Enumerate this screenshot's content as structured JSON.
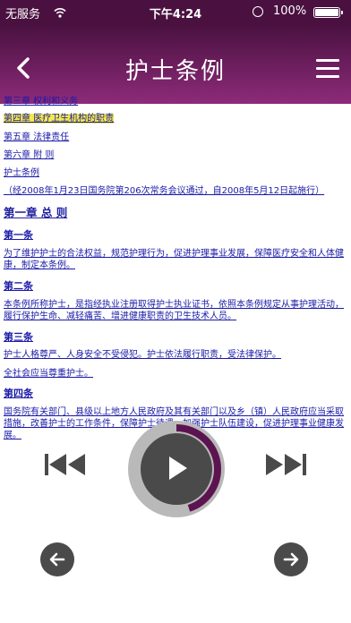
{
  "status_bar": {
    "carrier": "无服务",
    "time": "下午4:24",
    "battery_percent": "100%",
    "icons": [
      "wifi-icon",
      "orientation-lock-icon",
      "battery-icon"
    ]
  },
  "nav": {
    "title": "护士条例",
    "back_icon": "chevron-left-icon",
    "menu_icon": "hamburger-menu-icon"
  },
  "content": {
    "lines": [
      "第三章 权利和义务",
      "第四章 医疗卫生机构的职责",
      "第五章 法律责任",
      "第六章 附 则",
      "护士条例",
      "（经2008年1月23日国务院第206次常务会议通过，自2008年5月12日起施行）",
      "第一章 总 则",
      "第一条",
      "为了维护护士的合法权益，规范护理行为，促进护理事业发展，保障医疗安全和人体健康，制定本条例。",
      "第二条",
      "本条例所称护士，是指经执业注册取得护士执业证书，依照本条例规定从事护理活动，履行保护生命、减轻痛苦、增进健康职责的卫生技术人员。",
      "第三条",
      "护士人格尊严、人身安全不受侵犯。护士依法履行职责，受法律保护。",
      "全社会应当尊重护士。",
      "第四条",
      "国务院有关部门、县级以上地方人民政府及其有关部门以及乡（镇）人民政府应当采取措施，改善护士的工作条件，保障护士待遇，加强护士队伍建设，促进护理事业健康发展。"
    ],
    "highlight_color": "#f4e94e",
    "link_color": "#1a1aa8"
  },
  "player": {
    "progress": 0.45,
    "icons": [
      "skip-previous-icon",
      "play-icon",
      "skip-next-icon"
    ],
    "accent_color": "#5c1450"
  },
  "bottom_nav": {
    "icons": [
      "arrow-left-icon",
      "arrow-right-icon"
    ]
  },
  "theme": {
    "bar_dark": "#4a1140",
    "bar_light": "#8d2b7a"
  }
}
